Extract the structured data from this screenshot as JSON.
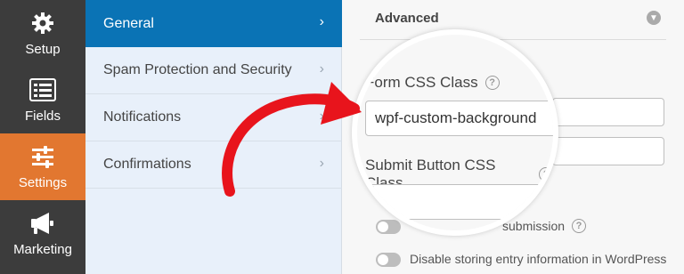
{
  "sidebar": {
    "items": [
      {
        "label": "Setup",
        "icon": "gear-icon"
      },
      {
        "label": "Fields",
        "icon": "list-icon"
      },
      {
        "label": "Settings",
        "icon": "sliders-icon",
        "active": true
      },
      {
        "label": "Marketing",
        "icon": "megaphone-icon"
      }
    ]
  },
  "sections": {
    "items": [
      {
        "label": "General",
        "active": true
      },
      {
        "label": "Spam Protection and Security"
      },
      {
        "label": "Notifications"
      },
      {
        "label": "Confirmations"
      }
    ]
  },
  "advanced": {
    "title": "Advanced",
    "form_css_label": "Form CSS Class",
    "form_css_value": "wpf-custom-background",
    "submit_css_label": "Submit Button CSS Class",
    "submit_css_value": "",
    "toggle_partial_label": "submission",
    "toggle_disable_label": "Disable storing entry information in WordPress"
  },
  "colors": {
    "accent_orange": "#e27730",
    "accent_blue": "#0a73b5",
    "arrow_red": "#e8141c"
  }
}
